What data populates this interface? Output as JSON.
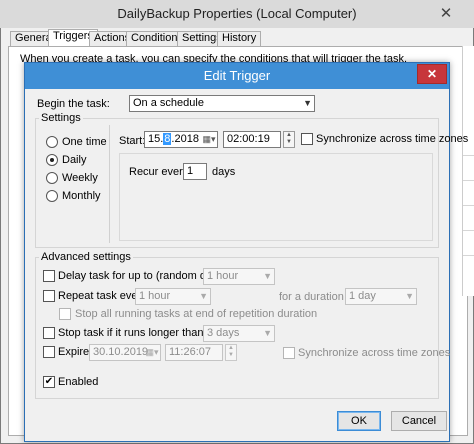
{
  "background": {
    "title": "DailyBackup Properties (Local Computer)",
    "close_glyph": "✕",
    "tabs": [
      "General",
      "Triggers",
      "Actions",
      "Conditions",
      "Settings",
      "History"
    ],
    "info_text": "When you create a task, you can specify the conditions that will trigger the task."
  },
  "dialog": {
    "title": "Edit Trigger",
    "close_glyph": "✕",
    "begin_task_label": "Begin the task:",
    "begin_task_value": "On a schedule",
    "settings": {
      "group_label": "Settings",
      "frequency_options": [
        "One time",
        "Daily",
        "Weekly",
        "Monthly"
      ],
      "selected_frequency": "Daily",
      "start_label": "Start:",
      "start_date_prefix": "15.",
      "start_date_selected": "8",
      "start_date_suffix": ".2018",
      "start_time": "02:00:19",
      "sync_label": "Synchronize across time zones",
      "sync_checked": false,
      "recur_label": "Recur every:",
      "recur_value": "1",
      "recur_unit": "days"
    },
    "advanced": {
      "group_label": "Advanced settings",
      "delay_label": "Delay task for up to (random delay):",
      "delay_value": "1 hour",
      "repeat_label": "Repeat task every:",
      "repeat_value": "1 hour",
      "duration_label": "for a duration of:",
      "duration_value": "1 day",
      "stop_running_label": "Stop all running tasks at end of repetition duration",
      "stop_longer_label": "Stop task if it runs longer than:",
      "stop_longer_value": "3 days",
      "expire_label": "Expire:",
      "expire_date": "30.10.2019",
      "expire_time": "11:26:07",
      "expire_sync_label": "Synchronize across time zones",
      "enabled_label": "Enabled",
      "enabled_checked": true
    },
    "ok_label": "OK",
    "cancel_label": "Cancel"
  },
  "colors": {
    "dialog_titlebar": "#3f8fd6",
    "close_button": "#c7363b",
    "selection": "#3399ff"
  }
}
